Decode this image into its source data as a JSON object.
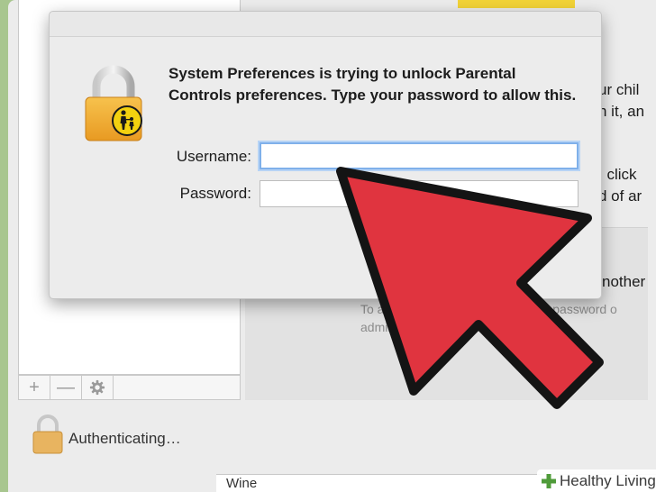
{
  "dialog": {
    "message": "System Preferences is trying to unlock Parental Controls preferences. Type your password to allow this.",
    "username_label": "Username:",
    "username_value": "",
    "password_label": "Password:",
    "password_value": ""
  },
  "background": {
    "right_text": [
      "ur chil",
      "n it, an",
      ", click",
      "d of ar"
    ],
    "other_label": "nother",
    "panel_desc": "To acce          hange parental settings          d password o administ          is cl",
    "status": "Authenticating…",
    "list_row": "Wine",
    "toolbar": {
      "add": "+",
      "remove": "—"
    }
  },
  "watermark": {
    "text": "Healthy Living"
  },
  "colors": {
    "arrow": "#e0343f",
    "lock_body": "#f2a833",
    "badge": "#f3d10f",
    "focus": "#7fb0ea",
    "frame": "#a8c68f"
  }
}
